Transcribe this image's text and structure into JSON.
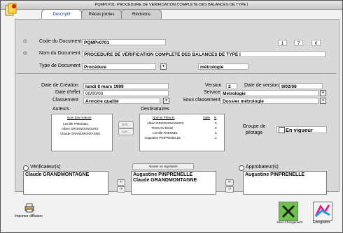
{
  "window": {
    "title": "PQMP0701: PROCEDURE DE VERIFICATION COMPLETE DES BALANCES DE TYPE I"
  },
  "tabs": [
    {
      "label": "Descriptif"
    },
    {
      "label": "Pièces jointes"
    },
    {
      "label": "Révisions"
    }
  ],
  "document": {
    "code_label": "Code du Document",
    "code_value": "PQMPr0701",
    "num1": "1",
    "num2": "7",
    "num3": "0",
    "name_label": "Nom du Document",
    "name_value": "PROCEDURE DE VERIFICATION COMPLETE DES BALANCES DE TYPE I",
    "type_label": "Type de Document",
    "type_value": "Procédure",
    "type_secondary": "métrologie"
  },
  "details": {
    "creation_label": "Date de Création",
    "creation_value": "lundi 8 mars 1999",
    "version_label": "Version",
    "version_value": "2",
    "version_date_label": "Date de version",
    "version_date_value": "9/02/08",
    "effet_label": "Date d'effet",
    "effet_value": "00/00/00",
    "service_label": "Service",
    "service_value": "Métrologie",
    "classement_label": "Classement",
    "classement_value": "Armoire qualité",
    "sous_classement_label": "Sous classement",
    "sous_classement_value": "Dossier métrologie"
  },
  "auteurs": {
    "title": "Auteurs",
    "header": "Nom des Auteurs",
    "rows": [
      "Lemille FRESNEL",
      "Albert GROSNOUNOURS",
      "Claude GRANDMONTAGNE"
    ]
  },
  "middle_buttons": {
    "delete": "Détr...",
    "add": "Ajou..."
  },
  "destinataires": {
    "title": "Destinataires",
    "headers": {
      "name": "Nom et Prénom",
      "salle": "Salle",
      "n": "N"
    },
    "rows": [
      {
        "name": "Albert GROSNOUNOURS",
        "n": "0"
      },
      {
        "name": "TOSCAN Émile",
        "n": "0"
      },
      {
        "name": "Lemille FRESNEL",
        "n": "0"
      },
      {
        "name": "Augustine PINPRENELLE",
        "n": "1"
      }
    ]
  },
  "pilotage": {
    "label": "Groupe de pilotage",
    "checkbox_label": "En vigueur"
  },
  "verificateurs": {
    "label": "Vérificateur(s)",
    "items": [
      "Claude GRANDMONTAGNE"
    ]
  },
  "signataire": {
    "button": "Ajouter un signataire",
    "items": [
      "Augustine PINPRENELLE",
      "Claude GRANDMONTAGNE"
    ]
  },
  "approbateurs": {
    "label": "Approbateur(s)",
    "items": [
      "Augustine PINPRENELLE"
    ]
  },
  "arrows": {
    "left": "<-",
    "right": "->"
  },
  "footer": {
    "print_label": "Imprimer diffusion",
    "cancel_label": "Sans Changement",
    "save_label": "Enregistrer"
  },
  "colors": {
    "accent_blue": "#1a3d7a",
    "panel_gray": "#d9d9d9"
  }
}
